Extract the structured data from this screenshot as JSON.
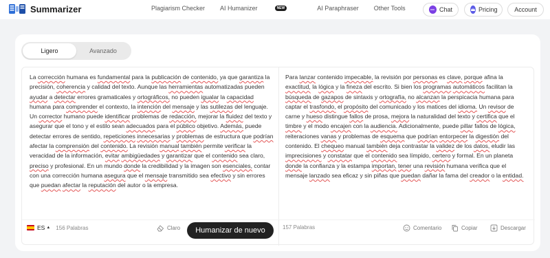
{
  "colors": {
    "accent": "#222222",
    "background": "#f2f3f5",
    "chat": "#7b3fe4",
    "pricing": "#5b5be6",
    "spellcheck": "#e25555"
  },
  "brand": {
    "name": "Summarizer",
    "icon": "summarizer-logo-icon"
  },
  "nav": {
    "items": [
      "Plagiarism Checker",
      "AI Humanizer",
      "AI Paraphraser",
      "Other Tools"
    ],
    "new_badge": "NEW"
  },
  "actions": {
    "chat": "Chat",
    "pricing": "Pricing",
    "account": "Account"
  },
  "modes": {
    "options": [
      "Ligero",
      "Avanzado"
    ],
    "selected": "Ligero"
  },
  "input": {
    "language": "ES",
    "word_count": "156 Palabras",
    "clear_label": "Claro",
    "text": "La corrección humana es fundamental para la publicación de contenido, ya que garantiza la precisión, coherencia y calidad del texto. Aunque las herramientas automatizadas pueden ayudar a detectar errores gramaticales y ortográficos, no pueden igualar la capacidad humana para comprender el contexto, la intención del mensaje y las sutilezas del lenguaje. Un corrector humano puede identificar problemas de redacción, mejorar la fluidez del texto y asegurar que el tono y el estilo sean adecuados para el público objetivo. Además, puede detectar errores de sentido, repeticiones innecesarias y problemas de estructura que podrían afectar la comprensión del contenido. La revisión manual también permite verificar la veracidad de la información, evitar ambigüedades y garantizar que el contenido sea claro, preciso y profesional. En un mundo donde la credibilidad y la imagen son esenciales, contar con una corrección humana asegura que el mensaje transmitido sea efectivo y sin errores que puedan afectar la reputación del autor o la empresa."
  },
  "humanize_button": "Humanizar de nuevo",
  "output": {
    "word_count": "157 Palabras",
    "comment_label": "Comentario",
    "copy_label": "Copiar",
    "download_label": "Descargar",
    "text": "Para lanzar contenido impecable, la revisión por personas es clave, porque afina la exactitud, la lógica y la fineza del escrito. Si bien los programas automáticos facilitan la búsqueda de gazapos de sintaxis y ortografía, no alcanzan la perspicacia humana para captar el trasfondo, el propósito del comunicado y los matices del idioma. Un revisor de carne y hueso distingue fallos de prosa, mejora la naturalidad del texto y certifica que el timbre y el modo encajen con la audiencia. Adicionalmente, puede pillar fallos de lógica, reiteraciones vanas y problemas de esquema que podrían entorpecer la digestión del contenido. El chequeo manual también deja contrastar la validez de los datos, eludir las imprecisiones y constatar que el contenido sea límpido, certero y formal. En un planeta donde la confianza y la estampa importan, tener una revisión humana verifica que el mensaje lanzado sea eficaz y sin piñas que puedan dañar la fama del creador o la entidad."
  }
}
